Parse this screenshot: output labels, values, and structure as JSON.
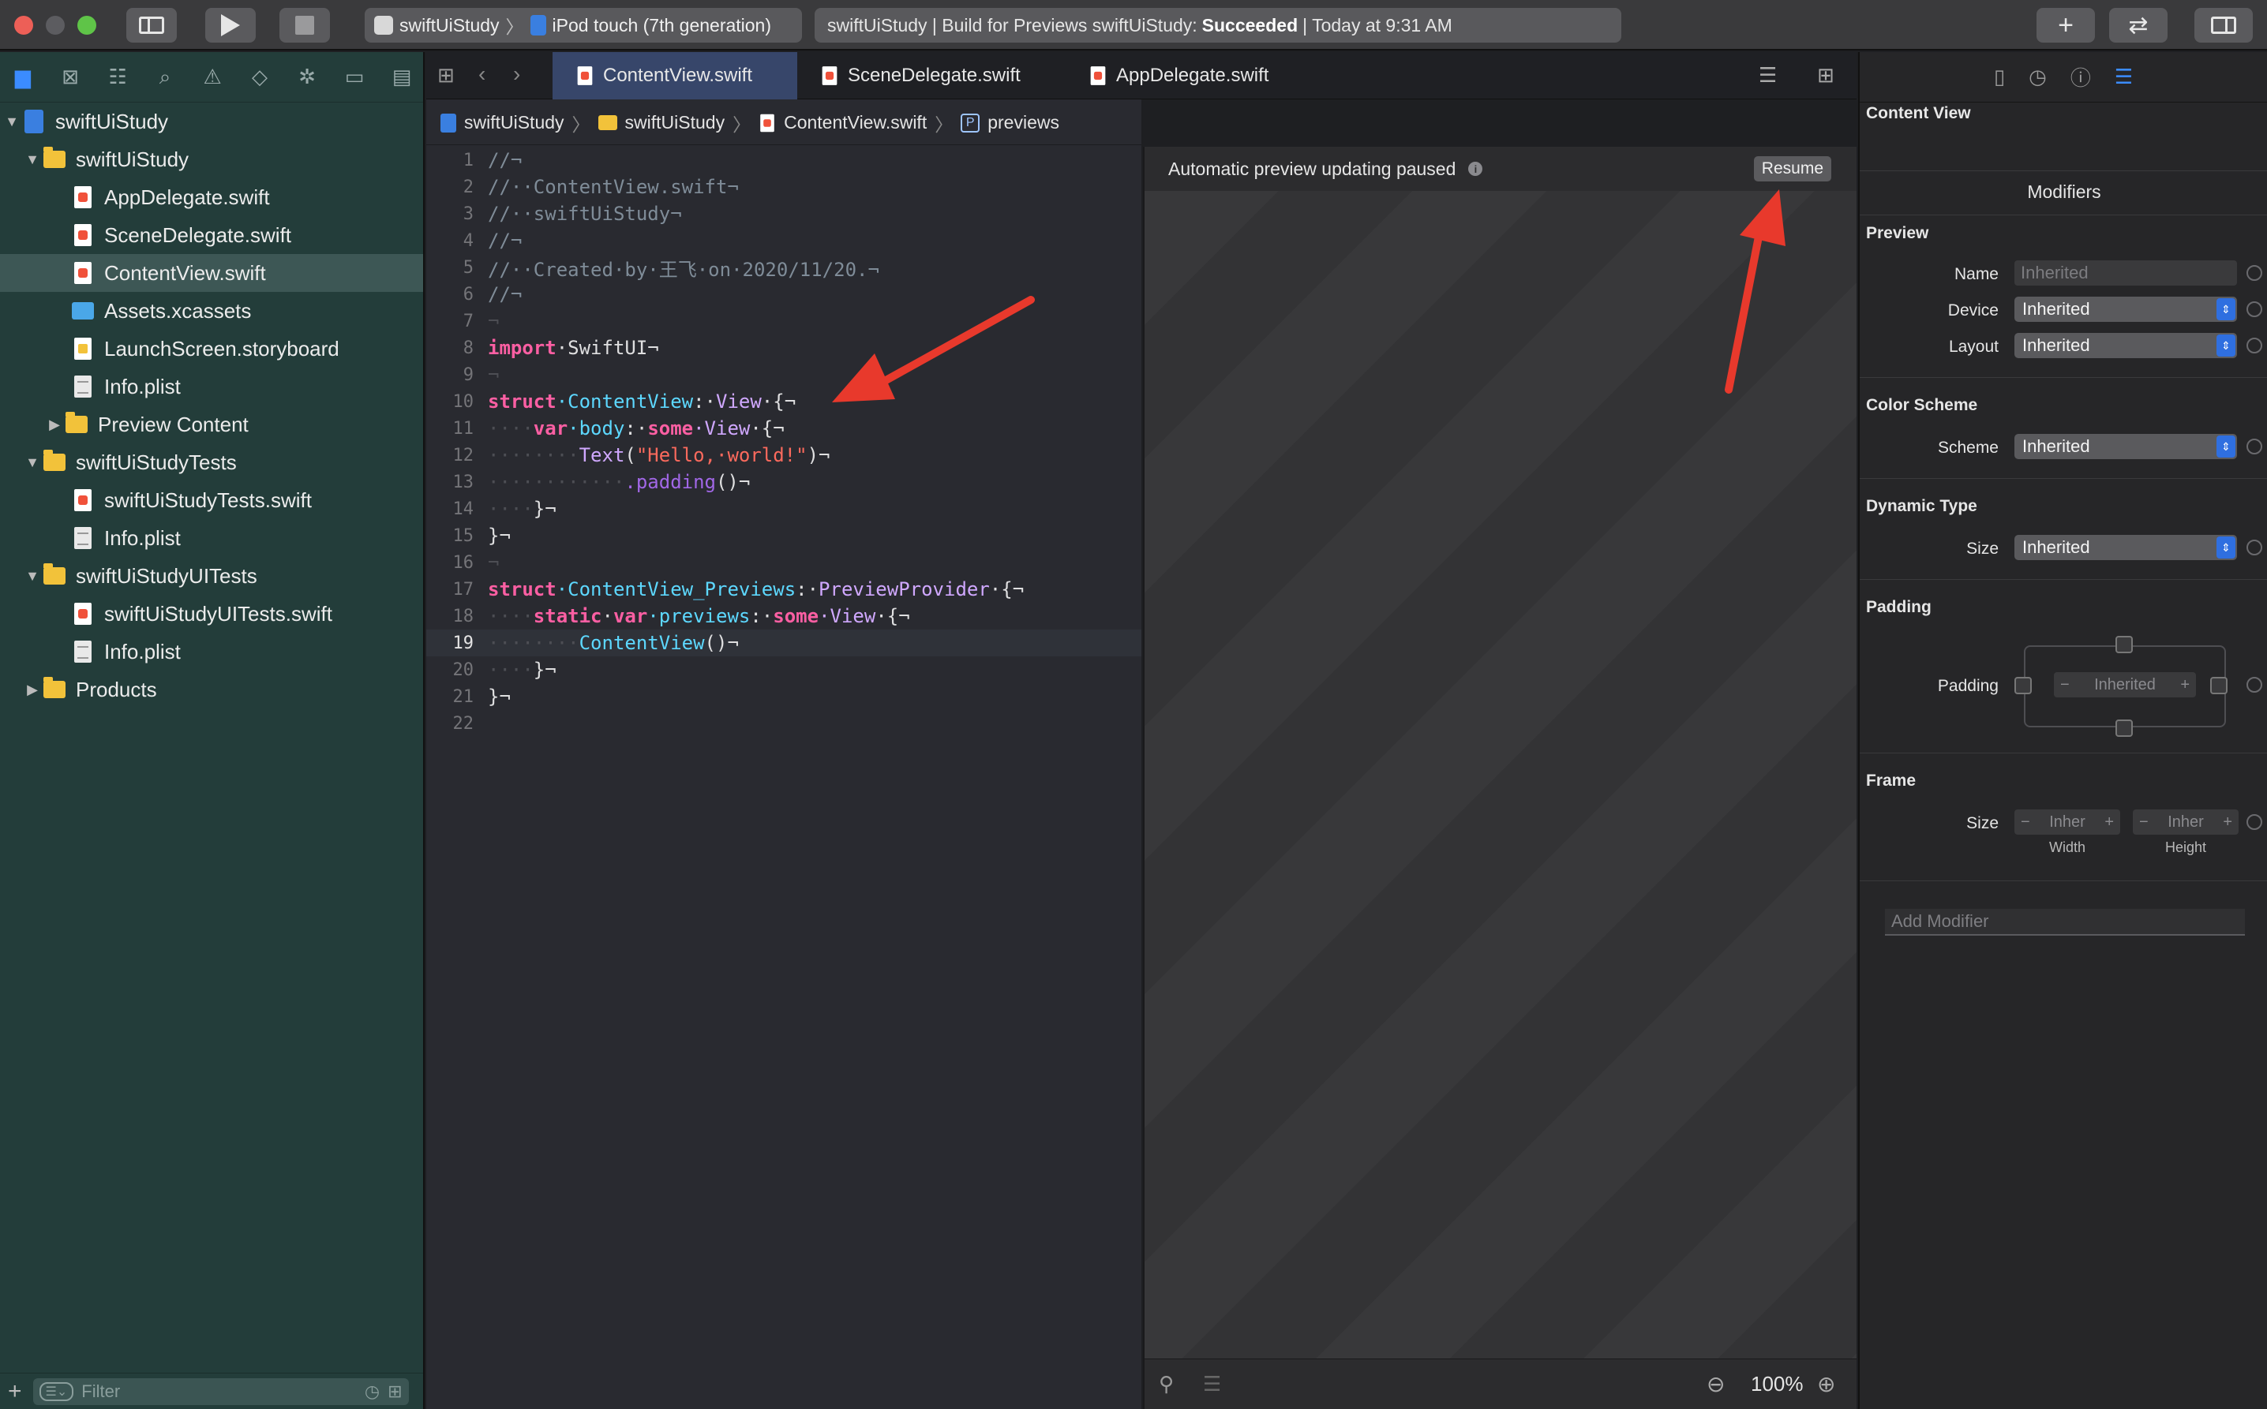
{
  "toolbar": {
    "scheme_target": "swiftUiStudy",
    "device": "iPod touch (7th generation)",
    "activity_prefix": "swiftUiStudy | Build for Previews swiftUiStudy:",
    "activity_status": "Succeeded",
    "activity_time": "| Today at 9:31 AM"
  },
  "navigator": {
    "filter_placeholder": "Filter",
    "items": [
      {
        "label": "swiftUiStudy"
      },
      {
        "label": "swiftUiStudy"
      },
      {
        "label": "AppDelegate.swift"
      },
      {
        "label": "SceneDelegate.swift"
      },
      {
        "label": "ContentView.swift"
      },
      {
        "label": "Assets.xcassets"
      },
      {
        "label": "LaunchScreen.storyboard"
      },
      {
        "label": "Info.plist"
      },
      {
        "label": "Preview Content"
      },
      {
        "label": "swiftUiStudyTests"
      },
      {
        "label": "swiftUiStudyTests.swift"
      },
      {
        "label": "Info.plist"
      },
      {
        "label": "swiftUiStudyUITests"
      },
      {
        "label": "swiftUiStudyUITests.swift"
      },
      {
        "label": "Info.plist"
      },
      {
        "label": "Products"
      }
    ]
  },
  "tabs": [
    "ContentView.swift",
    "SceneDelegate.swift",
    "AppDelegate.swift"
  ],
  "breadcrumb": [
    "swiftUiStudy",
    "swiftUiStudy",
    "ContentView.swift",
    "previews"
  ],
  "breadcrumb_badge": "P",
  "code": {
    "line_numbers": [
      "1",
      "2",
      "3",
      "4",
      "5",
      "6",
      "7",
      "8",
      "9",
      "10",
      "11",
      "12",
      "13",
      "14",
      "15",
      "16",
      "17",
      "18",
      "19",
      "20",
      "21",
      "22"
    ],
    "lines": {
      "l1": "//¬",
      "l2": "//··ContentView.swift¬",
      "l3": "//··swiftUiStudy¬",
      "l4": "//¬",
      "l5": "//··Created·by·王飞·on·2020/11/20.¬",
      "l6": "//¬",
      "l7": "¬",
      "l8a": "import",
      "l8b": "·SwiftUI¬",
      "l9": "¬",
      "l10a": "struct",
      "l10b": "·ContentView",
      "l10c": ":·",
      "l10d": "View",
      "l10e": "·{¬",
      "l11a": "····",
      "l11b": "var",
      "l11c": "·body",
      "l11d": ":·",
      "l11e": "some",
      "l11f": "·View",
      "l11g": "·{¬",
      "l12a": "········",
      "l12b": "Text",
      "l12c": "(",
      "l12d": "\"Hello,·world!\"",
      "l12e": ")¬",
      "l13a": "············",
      "l13b": ".padding",
      "l13c": "()¬",
      "l14a": "····",
      "l14b": "}¬",
      "l15": "}¬",
      "l16": "¬",
      "l17a": "struct",
      "l17b": "·ContentView_Previews",
      "l17c": ":·",
      "l17d": "PreviewProvider",
      "l17e": "·{¬",
      "l18a": "····",
      "l18b": "static",
      "l18c": "·",
      "l18d": "var",
      "l18e": "·previews",
      "l18f": ":·",
      "l18g": "some",
      "l18h": "·View",
      "l18i": "·{¬",
      "l19a": "········",
      "l19b": "ContentView",
      "l19c": "()¬",
      "l20a": "····",
      "l20b": "}¬",
      "l21": "}¬",
      "l22": ""
    }
  },
  "canvas": {
    "status": "Automatic preview updating paused",
    "resume_label": "Resume",
    "zoom": "100%"
  },
  "inspector": {
    "title": "Content View",
    "modifiers_header": "Modifiers",
    "preview": {
      "title": "Preview",
      "name_label": "Name",
      "name_placeholder": "Inherited",
      "device_label": "Device",
      "device_value": "Inherited",
      "layout_label": "Layout",
      "layout_value": "Inherited"
    },
    "color_scheme": {
      "title": "Color Scheme",
      "scheme_label": "Scheme",
      "scheme_value": "Inherited"
    },
    "dynamic_type": {
      "title": "Dynamic Type",
      "size_label": "Size",
      "size_value": "Inherited"
    },
    "padding": {
      "title": "Padding",
      "label": "Padding",
      "value": "Inherited",
      "minus": "−",
      "plus": "+"
    },
    "frame": {
      "title": "Frame",
      "size_label": "Size",
      "width_value": "Inher",
      "height_value": "Inher",
      "width_label": "Width",
      "height_label": "Height",
      "minus": "−",
      "plus": "+"
    },
    "add_modifier_placeholder": "Add Modifier"
  },
  "colors": {
    "navigator_bg": "#233d3a",
    "editor_bg": "#292a30",
    "active_tab": "#37466a",
    "accent": "#3b8cff",
    "annotation_arrow": "#e8392c"
  }
}
